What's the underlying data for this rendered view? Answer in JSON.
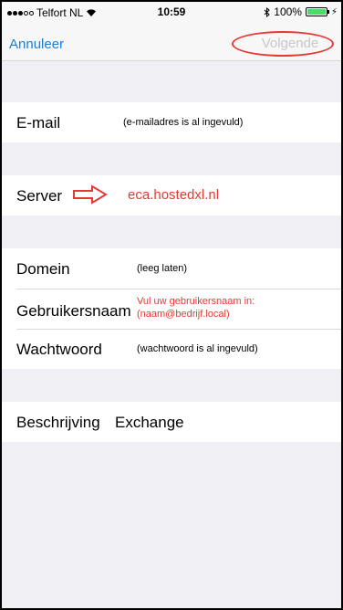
{
  "status_bar": {
    "carrier": "Telfort NL",
    "time": "10:59",
    "bluetooth_icon": "bluetooth-icon",
    "battery_percent": "100%"
  },
  "nav": {
    "cancel_label": "Annuleer",
    "next_label": "Volgende"
  },
  "form": {
    "email": {
      "label": "E-mail",
      "note": "(e-mailadres is al ingevuld)"
    },
    "server": {
      "label": "Server",
      "value": "eca.hostedxl.nl"
    },
    "domain": {
      "label": "Domein",
      "note": "(leeg laten)"
    },
    "username": {
      "label": "Gebruikersnaam",
      "note_line1": "Vul uw gebruikersnaam in:",
      "note_line2": "(naam@bedrijf.local)"
    },
    "password": {
      "label": "Wachtwoord",
      "note": "(wachtwoord is al ingevuld)"
    },
    "description": {
      "label": "Beschrijving",
      "value": "Exchange"
    }
  },
  "colors": {
    "accent": "#1a7fd6",
    "annotation_red": "#e53935",
    "disabled": "#c7c7cc",
    "background": "#efeff4",
    "battery": "#4cd964"
  }
}
